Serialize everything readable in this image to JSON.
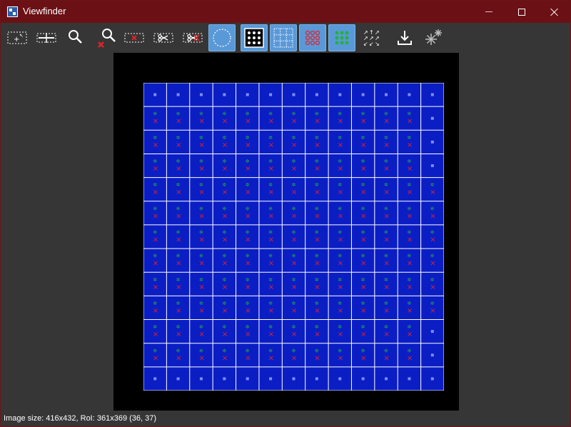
{
  "window": {
    "title": "Viewfinder",
    "minimize_icon": "minimize-icon",
    "maximize_icon": "maximize-icon",
    "close_icon": "close-icon",
    "title_color": "#6b1116"
  },
  "toolbar": {
    "active_color": "#5a99d8",
    "buttons": [
      {
        "name": "select-roi-button",
        "icon": "select-roi-icon",
        "active": true
      },
      {
        "name": "pan-horizontal-button",
        "icon": "pan-horizontal-icon",
        "active": false
      },
      {
        "name": "zoom-button",
        "icon": "magnifier-icon",
        "active": false
      },
      {
        "name": "zoom-reset-button",
        "icon": "magnifier-clear-icon",
        "active": false
      },
      {
        "name": "delete-roi-button",
        "icon": "delete-roi-icon",
        "active": false
      },
      {
        "name": "cut-roi-button",
        "icon": "scissors-icon",
        "active": false
      },
      {
        "name": "cut-delete-button",
        "icon": "scissors-delete-icon",
        "active": false
      },
      {
        "name": "circle-mask-button",
        "icon": "circle-icon",
        "active": true
      },
      {
        "name": "show-spots-button",
        "icon": "spot-grid-icon",
        "active": true
      },
      {
        "name": "show-grid-button",
        "icon": "grid-icon",
        "active": true
      },
      {
        "name": "show-red-spots-button",
        "icon": "red-spots-icon",
        "active": true
      },
      {
        "name": "show-green-spots-button",
        "icon": "green-spots-icon",
        "active": true
      },
      {
        "name": "spread-button",
        "icon": "spread-arrows-icon",
        "active": false
      },
      {
        "name": "export-button",
        "icon": "download-icon",
        "active": false
      },
      {
        "name": "auto-detect-button",
        "icon": "sparkle-icon",
        "active": false
      }
    ]
  },
  "grid": {
    "rows": 13,
    "cols": 13,
    "colors": {
      "background": "#0b1ec4",
      "gridline": "#ffffff",
      "square_marker": "#7d8cff",
      "cross_marker": "#e0242a",
      "star_marker": "#27b03a",
      "orange_marker": "#e07b20"
    }
  },
  "status": {
    "text": "Image size: 416x432, RoI: 361x369 (36, 37)"
  }
}
